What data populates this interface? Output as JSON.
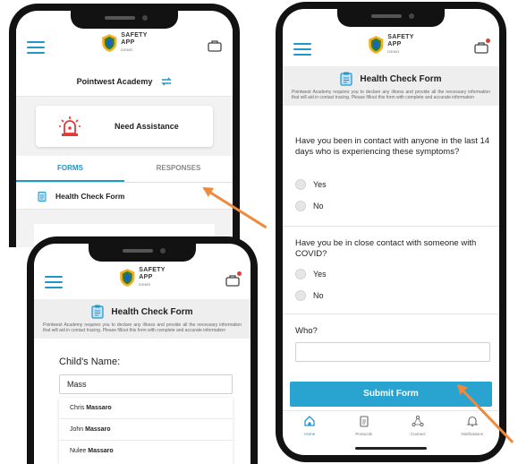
{
  "brand": {
    "line1": "SAFETY",
    "line2": "APP",
    "line3": "DEMO"
  },
  "left_phone": {
    "school_name": "Pointwest Academy",
    "assist_label": "Need Assistance",
    "tabs": [
      "FORMS",
      "RESPONSES"
    ],
    "form_item": "Health Check Form"
  },
  "form_header": {
    "title": "Health Check Form",
    "description": "Pointwest Academy requires you to declare any illness and provide all the necessary information that will aid in contact tracing. Please fillout this form with complete and accurate information"
  },
  "bottom_phone": {
    "childs_name_label": "Child's Name:",
    "name_value": "Mass",
    "suggestions": [
      {
        "first": "Chris",
        "last": "Massaro"
      },
      {
        "first": "John",
        "last": "Massaro"
      },
      {
        "first": "Nulee",
        "last": "Massaro"
      }
    ]
  },
  "right_phone": {
    "q1": "Have you been in contact with anyone in the last 14 days who is experiencing these symptoms?",
    "q2": "Have you be in close contact with someone with COVID?",
    "yes": "Yes",
    "no": "No",
    "who_label": "Who?",
    "who_value": "",
    "submit": "Submit Form",
    "nav": [
      "Home",
      "Protocols",
      "Connect",
      "Notifications"
    ]
  },
  "colors": {
    "accent": "#2196c9",
    "submit": "#29a3cf",
    "alert": "#e53935",
    "arrow": "#ef8a3c"
  }
}
